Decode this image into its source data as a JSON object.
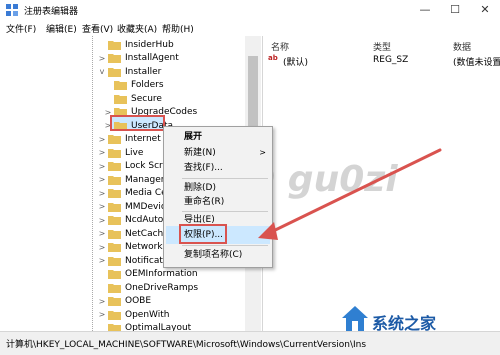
{
  "window": {
    "title": "注册表编辑器",
    "min": "—",
    "max": "☐",
    "close": "✕"
  },
  "menu": [
    "文件(F)",
    "编辑(E)",
    "查看(V)",
    "收藏夹(A)",
    "帮助(H)"
  ],
  "tree": {
    "items": [
      {
        "label": "InsiderHub",
        "chev": ""
      },
      {
        "label": "InstallAgent",
        "chev": ">"
      },
      {
        "label": "Installer",
        "chev": "v"
      },
      {
        "label": "Folders",
        "chev": ""
      },
      {
        "label": "Secure",
        "chev": ""
      },
      {
        "label": "UpgradeCodes",
        "chev": ">"
      },
      {
        "label": "UserData",
        "chev": ">"
      },
      {
        "label": "Internet Sett",
        "chev": ">"
      },
      {
        "label": "Live",
        "chev": ">"
      },
      {
        "label": "Lock Screen",
        "chev": ">"
      },
      {
        "label": "Managemen",
        "chev": ">"
      },
      {
        "label": "Media Cente",
        "chev": ">"
      },
      {
        "label": "MMDevices",
        "chev": ">"
      },
      {
        "label": "NcdAutoSetu",
        "chev": ">"
      },
      {
        "label": "NetCache",
        "chev": ">"
      },
      {
        "label": "NetworkServ",
        "chev": ">"
      },
      {
        "label": "Notifications",
        "chev": ">"
      },
      {
        "label": "OEMInformation",
        "chev": ""
      },
      {
        "label": "OneDriveRamps",
        "chev": ""
      },
      {
        "label": "OOBE",
        "chev": ">"
      },
      {
        "label": "OpenWith",
        "chev": ">"
      },
      {
        "label": "OptimalLayout",
        "chev": ""
      }
    ]
  },
  "list": {
    "headers": {
      "name": "名称",
      "type": "类型",
      "data": "数据"
    },
    "row": {
      "name": "(默认)",
      "type": "REG_SZ",
      "data": "(数值未设置)"
    },
    "icon": "ab"
  },
  "context_menu": {
    "items": [
      {
        "label": "展开",
        "arrow": ""
      },
      {
        "label": "新建(N)",
        "arrow": ">"
      },
      {
        "label": "查找(F)...",
        "arrow": ""
      },
      {
        "label": "删除(D)",
        "arrow": ""
      },
      {
        "label": "重命名(R)",
        "arrow": ""
      },
      {
        "label": "导出(E)",
        "arrow": ""
      },
      {
        "label": "权限(P)...",
        "arrow": ""
      },
      {
        "label": "复制项名称(C)",
        "arrow": ""
      }
    ]
  },
  "status": "计算机\\HKEY_LOCAL_MACHINE\\SOFTWARE\\Microsoft\\Windows\\CurrentVersion\\Ins",
  "watermark": "百度ID gu0zi",
  "logo_text": "系统之家",
  "colors": {
    "highlight": "#cce8ff",
    "annotation": "#d9534f",
    "folder": "#e8c25a"
  }
}
